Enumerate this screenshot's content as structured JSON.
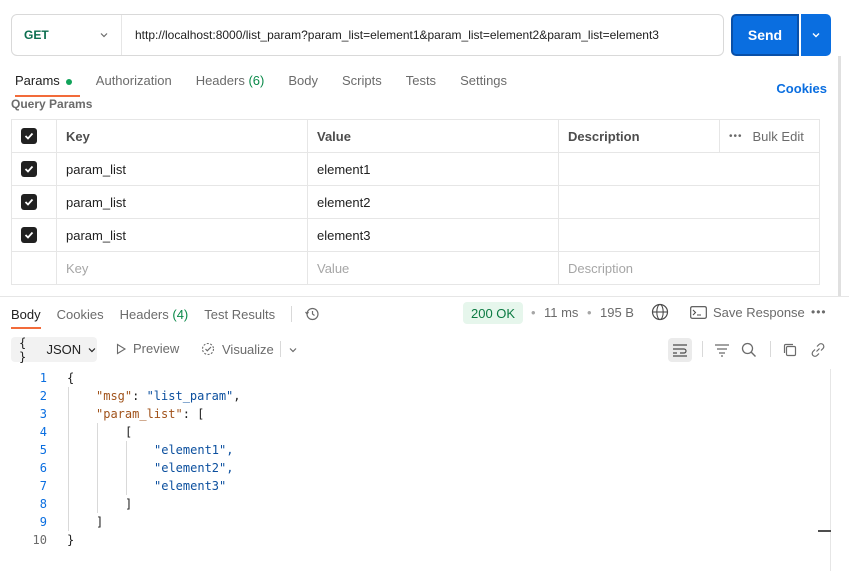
{
  "request": {
    "method": "GET",
    "url": "http://localhost:8000/list_param?param_list=element1&param_list=element2&param_list=element3",
    "send_label": "Send"
  },
  "req_tabs": {
    "params": "Params",
    "authorization": "Authorization",
    "headers": "Headers",
    "headers_count": "(6)",
    "body": "Body",
    "scripts": "Scripts",
    "tests": "Tests",
    "settings": "Settings",
    "cookies": "Cookies"
  },
  "query_params": {
    "title": "Query Params",
    "columns": {
      "key": "Key",
      "value": "Value",
      "description": "Description",
      "bulk_edit": "Bulk Edit"
    },
    "rows": [
      {
        "key": "param_list",
        "value": "element1",
        "description": ""
      },
      {
        "key": "param_list",
        "value": "element2",
        "description": ""
      },
      {
        "key": "param_list",
        "value": "element3",
        "description": ""
      }
    ],
    "placeholder": {
      "key": "Key",
      "value": "Value",
      "description": "Description"
    }
  },
  "response": {
    "tabs": {
      "body": "Body",
      "cookies": "Cookies",
      "headers": "Headers",
      "headers_count": "(4)",
      "test_results": "Test Results"
    },
    "status": "200 OK",
    "time": "11 ms",
    "size": "195 B",
    "save_label": "Save Response",
    "format": "JSON",
    "preview_label": "Preview",
    "visualize_label": "Visualize"
  },
  "code_lines": [
    {
      "n": "1",
      "text": "{"
    },
    {
      "n": "2",
      "text": "\"msg\": \"list_param\","
    },
    {
      "n": "3",
      "text": "\"param_list\": ["
    },
    {
      "n": "4",
      "text": "["
    },
    {
      "n": "5",
      "text": "\"element1\","
    },
    {
      "n": "6",
      "text": "\"element2\","
    },
    {
      "n": "7",
      "text": "\"element3\""
    },
    {
      "n": "8",
      "text": "]"
    },
    {
      "n": "9",
      "text": "]"
    },
    {
      "n": "10",
      "text": "}"
    }
  ],
  "colors": {
    "send": "#0a6ee0",
    "method": "#0b6e4f",
    "active_tab": "#f26b3a",
    "status_bg": "#e6f6ec",
    "json_key": "#a0521a",
    "json_string": "#0b4f9e"
  }
}
